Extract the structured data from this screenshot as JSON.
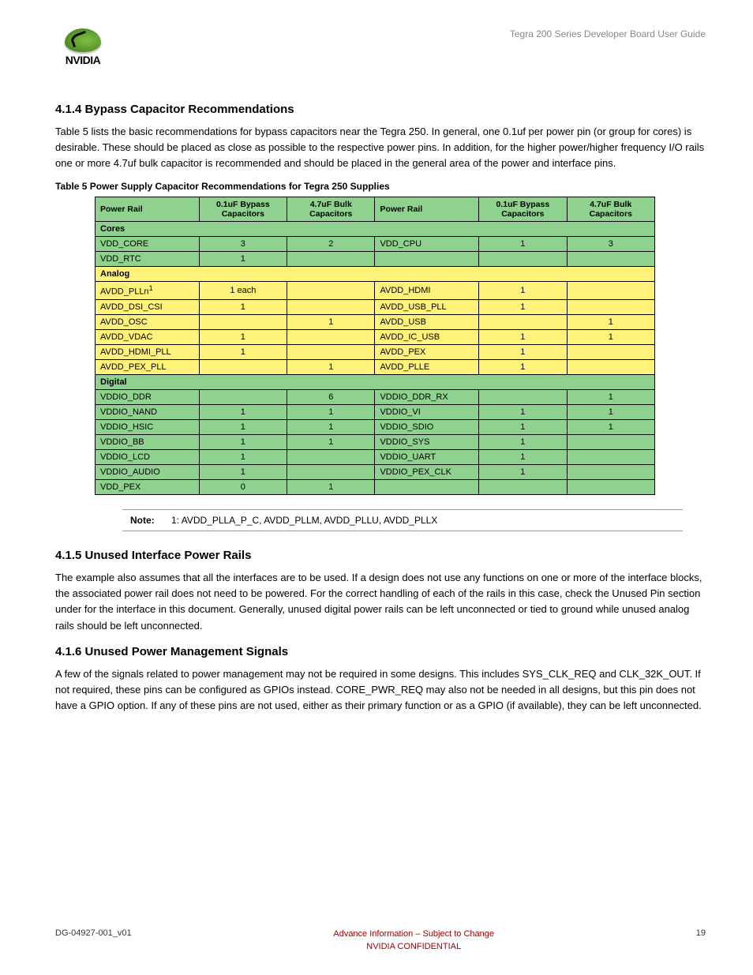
{
  "header": {
    "doc_title": "Tegra 200 Series Developer Board User Guide",
    "logo_text": "NVIDIA"
  },
  "sections": {
    "s414": {
      "heading": "4.1.4  Bypass Capacitor Recommendations",
      "para": "Table 5 lists the basic recommendations for bypass capacitors near the Tegra 250.  In general, one 0.1uf per power pin (or group for cores) is desirable.  These should be placed as close as possible to the respective power pins.  In addition, for the higher power/higher frequency I/O rails one or more 4.7uf bulk capacitor is recommended and should be placed in the general area of the power and interface pins."
    },
    "s415": {
      "heading": "4.1.5  Unused Interface Power Rails",
      "para": "The example also assumes that all the interfaces are to be used.  If a design does not use any functions on one or more of the interface blocks, the associated power rail does not need to be powered.  For the correct handling of each of the rails in this case, check the Unused Pin section under for the interface in this document.  Generally, unused digital power rails can be left unconnected or tied to ground while unused analog rails should be left unconnected."
    },
    "s416": {
      "heading": "4.1.6  Unused Power Management Signals",
      "para": "A few of the signals related to power management may not be required in some designs.  This includes SYS_CLK_REQ and CLK_32K_OUT.  If not required, these pins can be configured as GPIOs instead.  CORE_PWR_REQ may also not be needed in all designs, but this pin does not have a GPIO option.  If any of these pins are not used, either as their primary function or as a GPIO (if available), they can be left unconnected."
    }
  },
  "table": {
    "caption": "Table 5  Power Supply Capacitor Recommendations for Tegra 250 Supplies",
    "headers": {
      "rail": "Power Rail",
      "bypass": "0.1uF Bypass Capacitors",
      "bulk": "4.7uF Bulk Capacitors"
    },
    "groups": {
      "cores": "Cores",
      "analog": "Analog",
      "digital": "Digital"
    },
    "rows": {
      "cores": [
        {
          "l1": "VDD_CORE",
          "b1": "3",
          "k1": "2",
          "l2": "VDD_CPU",
          "b2": "1",
          "k2": "3"
        },
        {
          "l1": "VDD_RTC",
          "b1": "1",
          "k1": "",
          "l2": "",
          "b2": "",
          "k2": ""
        }
      ],
      "analog": [
        {
          "l1": "AVDD_PLLn",
          "sup": "1",
          "b1": "1 each",
          "k1": "",
          "l2": "AVDD_HDMI",
          "b2": "1",
          "k2": ""
        },
        {
          "l1": "AVDD_DSI_CSI",
          "b1": "1",
          "k1": "",
          "l2": "AVDD_USB_PLL",
          "b2": "1",
          "k2": ""
        },
        {
          "l1": "AVDD_OSC",
          "b1": "",
          "k1": "1",
          "l2": "AVDD_USB",
          "b2": "",
          "k2": "1"
        },
        {
          "l1": "AVDD_VDAC",
          "b1": "1",
          "k1": "",
          "l2": "AVDD_IC_USB",
          "b2": "1",
          "k2": "1"
        },
        {
          "l1": "AVDD_HDMI_PLL",
          "b1": "1",
          "k1": "",
          "l2": "AVDD_PEX",
          "b2": "1",
          "k2": ""
        },
        {
          "l1": "AVDD_PEX_PLL",
          "b1": "",
          "k1": "1",
          "l2": "AVDD_PLLE",
          "b2": "1",
          "k2": ""
        }
      ],
      "digital": [
        {
          "l1": "VDDIO_DDR",
          "b1": "",
          "k1": "6",
          "l2": "VDDIO_DDR_RX",
          "b2": "",
          "k2": "1"
        },
        {
          "l1": "VDDIO_NAND",
          "b1": "1",
          "k1": "1",
          "l2": "VDDIO_VI",
          "b2": "1",
          "k2": "1"
        },
        {
          "l1": "VDDIO_HSIC",
          "b1": "1",
          "k1": "1",
          "l2": "VDDIO_SDIO",
          "b2": "1",
          "k2": "1"
        },
        {
          "l1": "VDDIO_BB",
          "b1": "1",
          "k1": "1",
          "l2": "VDDIO_SYS",
          "b2": "1",
          "k2": ""
        },
        {
          "l1": "VDDIO_LCD",
          "b1": "1",
          "k1": "",
          "l2": "VDDIO_UART",
          "b2": "1",
          "k2": ""
        },
        {
          "l1": "VDDIO_AUDIO",
          "b1": "1",
          "k1": "",
          "l2": "VDDIO_PEX_CLK",
          "b2": "1",
          "k2": ""
        },
        {
          "l1": "VDD_PEX",
          "b1": "0",
          "k1": "1",
          "l2": "",
          "b2": "",
          "k2": ""
        }
      ]
    }
  },
  "note": {
    "label": "Note:",
    "text": "1:  AVDD_PLLA_P_C, AVDD_PLLM, AVDD_PLLU, AVDD_PLLX"
  },
  "footer": {
    "left": "DG-04927-001_v01",
    "center1": "Advance Information – Subject to Change",
    "center2": "NVIDIA CONFIDENTIAL",
    "right": "19"
  }
}
